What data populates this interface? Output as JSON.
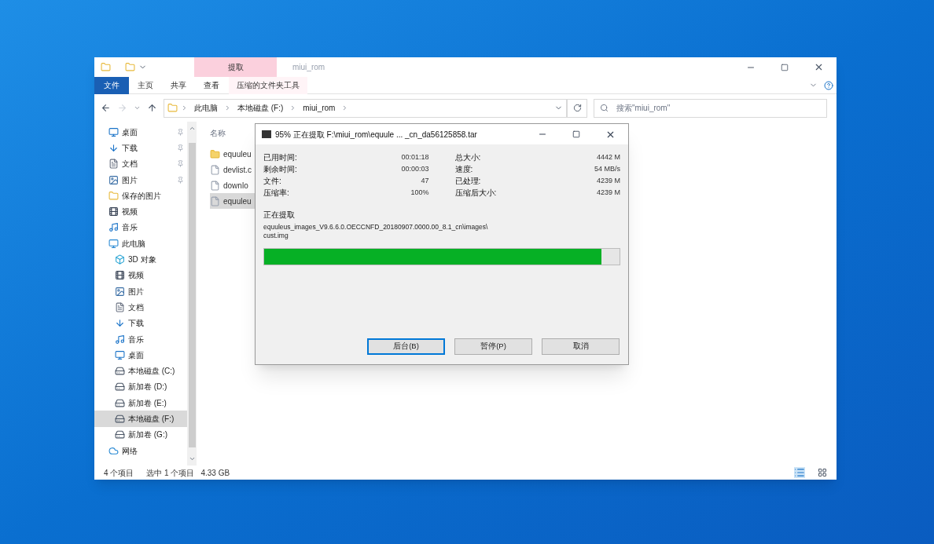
{
  "window": {
    "title": "miui_rom"
  },
  "ribbon": {
    "context_label": "提取",
    "tabs": [
      {
        "label": "文件",
        "kind": "file"
      },
      {
        "label": "主页",
        "kind": "plain"
      },
      {
        "label": "共享",
        "kind": "plain"
      },
      {
        "label": "查看",
        "kind": "plain"
      },
      {
        "label": "压缩的文件夹工具",
        "kind": "context"
      }
    ]
  },
  "address": {
    "path": [
      "此电脑",
      "本地磁盘 (F:)",
      "miui_rom"
    ],
    "search": {
      "placeholder": "搜索\"miui_rom\""
    }
  },
  "sidebar": {
    "items": [
      {
        "label": "桌面",
        "kind": "desktop",
        "pinned": true,
        "selected": false
      },
      {
        "label": "下载",
        "kind": "download",
        "pinned": true,
        "selected": false
      },
      {
        "label": "文档",
        "kind": "document",
        "pinned": true,
        "selected": false
      },
      {
        "label": "图片",
        "kind": "picture",
        "pinned": true,
        "selected": false
      },
      {
        "label": "保存的图片",
        "kind": "folder",
        "pinned": false,
        "selected": false
      },
      {
        "label": "视频",
        "kind": "video",
        "pinned": false,
        "selected": false
      },
      {
        "label": "音乐",
        "kind": "music",
        "pinned": false,
        "selected": false
      },
      {
        "label": "此电脑",
        "kind": "pc",
        "pinned": false,
        "selected": false,
        "children": [
          {
            "label": "3D 对象",
            "kind": "cube",
            "pinned": false,
            "selected": false
          },
          {
            "label": "视频",
            "kind": "video",
            "pinned": false,
            "selected": false
          },
          {
            "label": "图片",
            "kind": "picture",
            "pinned": false,
            "selected": false
          },
          {
            "label": "文档",
            "kind": "document",
            "pinned": false,
            "selected": false
          },
          {
            "label": "下载",
            "kind": "download",
            "pinned": false,
            "selected": false
          },
          {
            "label": "音乐",
            "kind": "music",
            "pinned": false,
            "selected": false
          },
          {
            "label": "桌面",
            "kind": "desktop",
            "pinned": false,
            "selected": false
          },
          {
            "label": "本地磁盘 (C:)",
            "kind": "drive",
            "pinned": false,
            "selected": false
          },
          {
            "label": "新加卷 (D:)",
            "kind": "drive",
            "pinned": false,
            "selected": false
          },
          {
            "label": "新加卷 (E:)",
            "kind": "drive",
            "pinned": false,
            "selected": false
          },
          {
            "label": "本地磁盘 (F:)",
            "kind": "drive",
            "pinned": false,
            "selected": true
          },
          {
            "label": "新加卷 (G:)",
            "kind": "drive",
            "pinned": false,
            "selected": false
          }
        ]
      },
      {
        "label": "网络",
        "kind": "network",
        "pinned": false,
        "selected": false
      }
    ]
  },
  "files": {
    "column_heading": "名称",
    "rows": [
      {
        "name": "equuleu",
        "kind": "folder",
        "selected": false
      },
      {
        "name": "devlist.c",
        "kind": "file",
        "selected": false
      },
      {
        "name": "downlo",
        "kind": "file",
        "selected": false
      },
      {
        "name": "equuleu",
        "kind": "file",
        "selected": true
      }
    ]
  },
  "status_bar": {
    "count": "4 个项目",
    "selection": "选中 1 个项目",
    "size": "4.33 GB"
  },
  "dialog": {
    "title": "95% 正在提取 F:\\miui_rom\\equule ... _cn_da56125858.tar",
    "stats_left": [
      {
        "label": "已用时间:",
        "value": "00:01:18"
      },
      {
        "label": "剩余时间:",
        "value": "00:00:03"
      },
      {
        "label": "文件:",
        "value": "47"
      },
      {
        "label": "压缩率:",
        "value": "100%"
      }
    ],
    "stats_right": [
      {
        "label": "总大小:",
        "value": "4442 M"
      },
      {
        "label": "速度:",
        "value": "54 MB/s"
      },
      {
        "label": "已处理:",
        "value": "4239 M"
      },
      {
        "label": "压缩后大小:",
        "value": "4239 M"
      }
    ],
    "section": "正在提取",
    "path_lines": [
      "equuleus_images_V9.6.6.0.OECCNFD_20180907.0000.00_8.1_cn\\images\\",
      "cust.img"
    ],
    "progress": {
      "level": 0.95
    },
    "buttons": [
      {
        "label": "后台(B)",
        "default": true
      },
      {
        "label": "暂停(P)",
        "default": false
      },
      {
        "label": "取消",
        "default": false
      }
    ]
  }
}
